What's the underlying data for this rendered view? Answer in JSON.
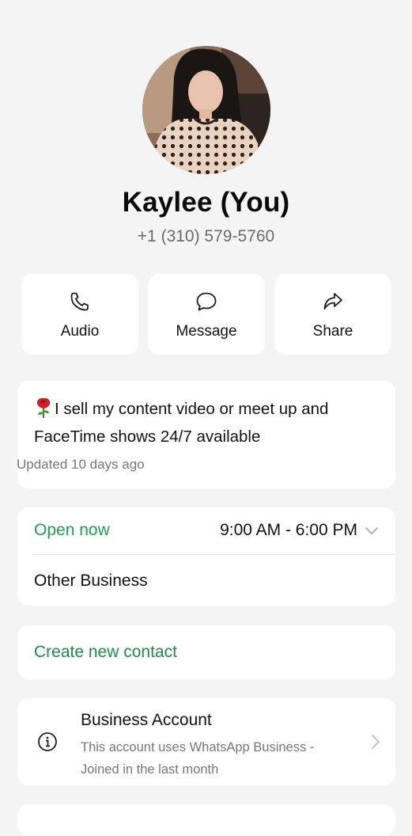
{
  "profile": {
    "name": "Kaylee (You)",
    "phone": "+1 (310) 579-5760"
  },
  "actions": [
    {
      "label": "Audio",
      "icon": "phone-icon"
    },
    {
      "label": "Message",
      "icon": "message-icon"
    },
    {
      "label": "Share",
      "icon": "share-icon"
    }
  ],
  "about": {
    "emoji": "rose",
    "text": "I sell my content video or meet up and FaceTime shows 24/7 available",
    "updated": "Updated 10 days ago"
  },
  "hours": {
    "status": "Open now",
    "range": "9:00 AM - 6:00 PM",
    "category": "Other Business"
  },
  "create_contact": {
    "label": "Create new contact"
  },
  "business_account": {
    "title": "Business Account",
    "description": "This account uses WhatsApp Business - Joined in the last month"
  },
  "colors": {
    "background": "#f4f4f4",
    "card": "#ffffff",
    "accent_green": "#1f9d55"
  }
}
